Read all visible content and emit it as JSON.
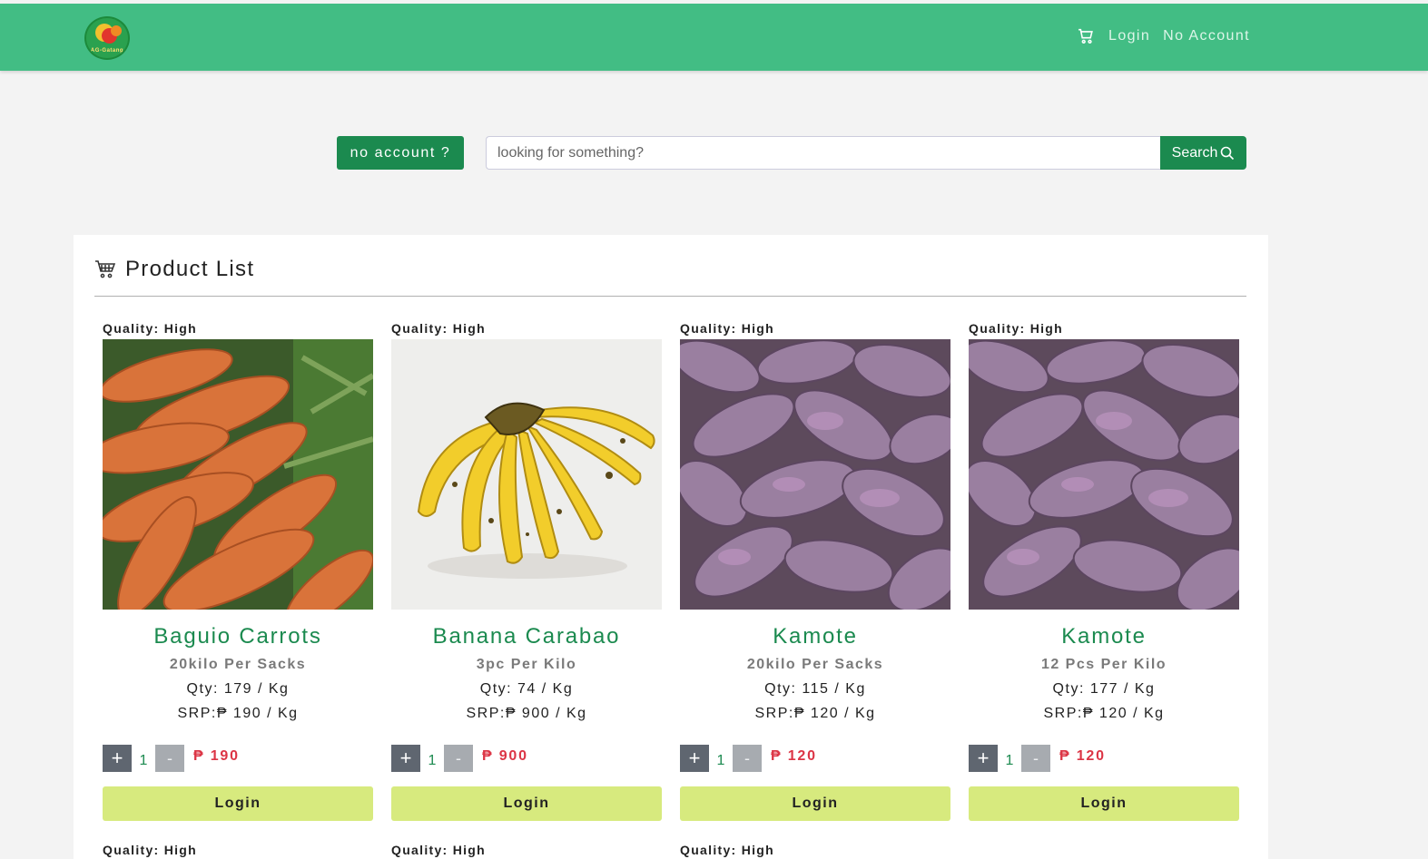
{
  "navbar": {
    "logo_text": "AG-Gatang",
    "links": {
      "login": "Login",
      "no_account": "No Account"
    }
  },
  "search": {
    "no_account_label": "no account ?",
    "placeholder": "looking for something?",
    "button_label": "Search"
  },
  "product_list": {
    "title": "Product List",
    "products": [
      {
        "quality": "Quality: High",
        "name": "Baguio Carrots",
        "unit": "20kilo Per Sacks",
        "qty": "Qty: 179 / Kg",
        "srp": "SRP:₱ 190 / Kg",
        "quantity_value": "1",
        "price": "₱ 190",
        "plus": "+",
        "minus": "-",
        "login_label": "Login",
        "image": "carrots"
      },
      {
        "quality": "Quality: High",
        "name": "Banana Carabao",
        "unit": "3pc Per Kilo",
        "qty": "Qty: 74 / Kg",
        "srp": "SRP:₱ 900 / Kg",
        "quantity_value": "1",
        "price": "₱ 900",
        "plus": "+",
        "minus": "-",
        "login_label": "Login",
        "image": "bananas"
      },
      {
        "quality": "Quality: High",
        "name": "Kamote",
        "unit": "20kilo Per Sacks",
        "qty": "Qty: 115 / Kg",
        "srp": "SRP:₱ 120 / Kg",
        "quantity_value": "1",
        "price": "₱ 120",
        "plus": "+",
        "minus": "-",
        "login_label": "Login",
        "image": "sweet-potatoes"
      },
      {
        "quality": "Quality: High",
        "name": "Kamote",
        "unit": "12 Pcs Per Kilo",
        "qty": "Qty: 177 / Kg",
        "srp": "SRP:₱ 120 / Kg",
        "quantity_value": "1",
        "price": "₱ 120",
        "plus": "+",
        "minus": "-",
        "login_label": "Login",
        "image": "sweet-potatoes"
      }
    ],
    "next_row_qualities": [
      "Quality: High",
      "Quality: High",
      "Quality: High"
    ]
  },
  "colors": {
    "navbar": "#42bd84",
    "primary_green": "#1b8a4f",
    "price_red": "#dc3545",
    "login_button": "#d7ea7e"
  }
}
